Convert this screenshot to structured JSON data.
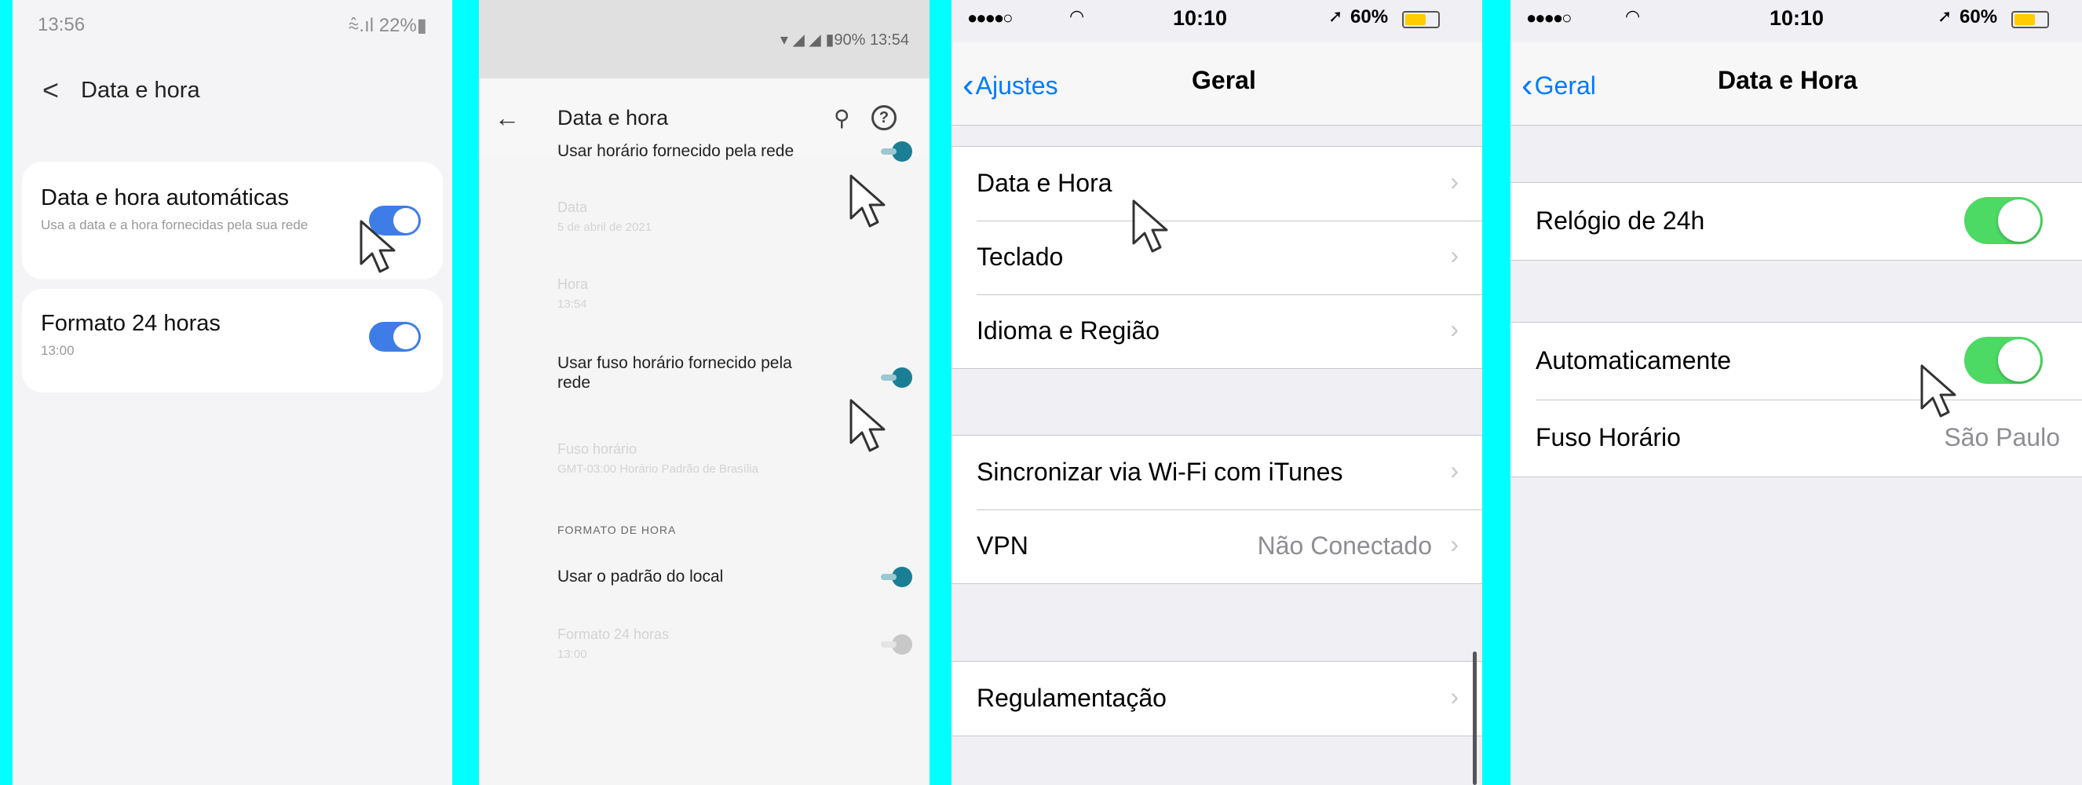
{
  "colors": {
    "background": "#00ffff",
    "samsung_toggle": "#3f7de6",
    "android_accent": "#1a7f95",
    "ios_green": "#4cd964",
    "ios_blue": "#007aff"
  },
  "samsung": {
    "status_time": "13:56",
    "status_right": "⩯.ıl 22%▮",
    "title": "Data e hora",
    "settings": [
      {
        "label": "Data e hora automáticas",
        "sub": "Usa a data e a hora fornecidas pela sua rede",
        "on": true
      },
      {
        "label": "Formato 24 horas",
        "sub": "13:00",
        "on": true
      }
    ]
  },
  "android": {
    "status_right": "▾ ◢ ◢ ▮90% 13:54",
    "title": "Data e hora",
    "items": {
      "network_time": {
        "label": "Usar horário fornecido pela rede",
        "on": true
      },
      "date": {
        "label": "Data",
        "sub": "5 de abril de 2021"
      },
      "time": {
        "label": "Hora",
        "sub": "13:54"
      },
      "network_zone": {
        "label": "Usar fuso horário fornecido pela rede",
        "on": true
      },
      "zone": {
        "label": "Fuso horário",
        "sub": "GMT-03:00 Horário Padrão de Brasília"
      },
      "section": "FORMATO DE HORA",
      "locale_default": {
        "label": "Usar o padrão do local",
        "on": true
      },
      "format24": {
        "label": "Formato 24 horas",
        "sub": "13:00",
        "on": false
      }
    }
  },
  "ios_general": {
    "status": {
      "dots": "●●●●○",
      "time": "10:10",
      "battery": "60%"
    },
    "back": "Ajustes",
    "title": "Geral",
    "rows": {
      "date_time": "Data e Hora",
      "keyboard": "Teclado",
      "language": "Idioma e Região",
      "itunes_sync": "Sincronizar via Wi-Fi com iTunes",
      "vpn": "VPN",
      "vpn_value": "Não Conectado",
      "regulatory": "Regulamentação"
    }
  },
  "ios_datetime": {
    "status": {
      "dots": "●●●●○",
      "time": "10:10",
      "battery": "60%"
    },
    "back": "Geral",
    "title": "Data e Hora",
    "rows": {
      "clock24": {
        "label": "Relógio de 24h",
        "on": true
      },
      "automatic": {
        "label": "Automaticamente",
        "on": true
      },
      "timezone": {
        "label": "Fuso Horário",
        "value": "São Paulo"
      }
    }
  }
}
